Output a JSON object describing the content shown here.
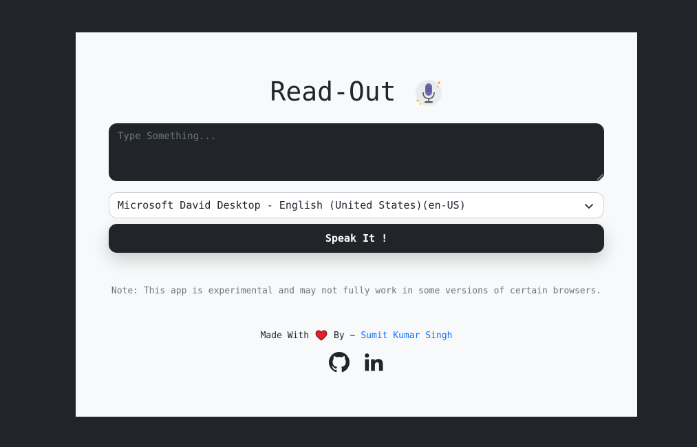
{
  "app": {
    "title": "Read-Out",
    "title_icon": "microphone-icon"
  },
  "input": {
    "placeholder": "Type Something...",
    "value": ""
  },
  "voice_select": {
    "selected": "Microsoft David Desktop - English (United States)(en-US)",
    "icon": "chevron-down-icon"
  },
  "actions": {
    "speak_label": "Speak It !"
  },
  "note": {
    "text": "Note: This app is experimental and may not fully work in some versions of certain browsers."
  },
  "footer": {
    "made_with": "Made With",
    "by": "By ~",
    "author": "Sumit Kumar Singh",
    "heart_icon": "heart-icon",
    "socials": [
      "github-icon",
      "linkedin-icon"
    ]
  },
  "colors": {
    "background": "#212529",
    "card": "#f8f9fa",
    "primary_dark": "#212529",
    "link": "#0d6efd",
    "heart": "#e0202a"
  }
}
